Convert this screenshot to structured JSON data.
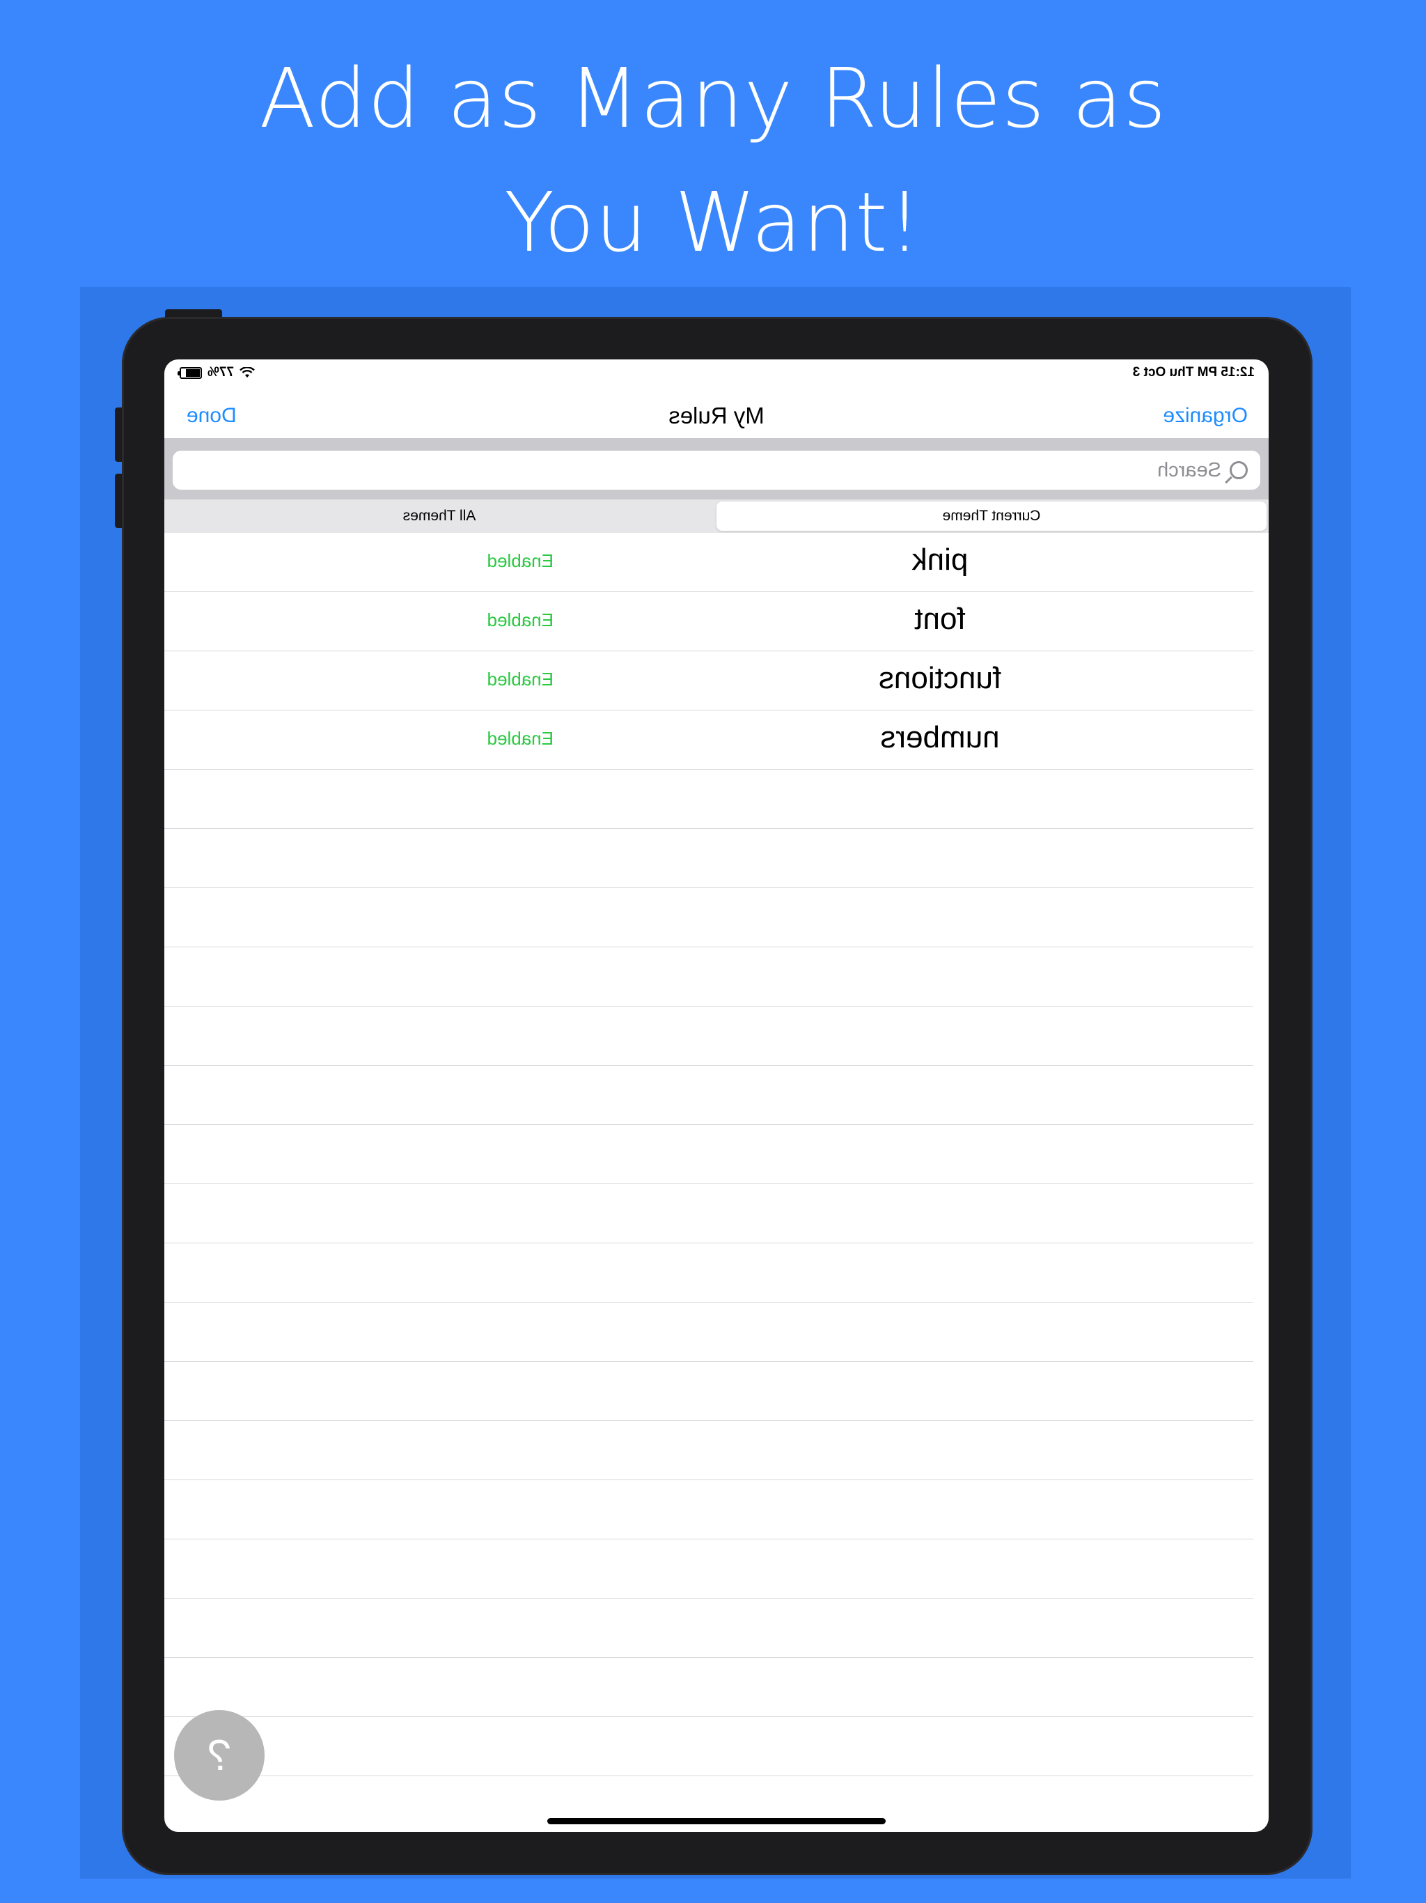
{
  "headline": {
    "line1": "Add as Many Rules as",
    "line2": "You Want!"
  },
  "status_bar": {
    "time_date": "12:15 PM  Thu Oct 3",
    "battery": "77%"
  },
  "nav": {
    "left_button": "Done",
    "title": "My Rules",
    "right_button": "Organize"
  },
  "search": {
    "placeholder": "Search"
  },
  "segments": {
    "current": "Current Theme",
    "all": "All Themes",
    "selected": "Current Theme"
  },
  "rules": [
    {
      "name": "pink",
      "status": "Enabled"
    },
    {
      "name": "font",
      "status": "Enabled"
    },
    {
      "name": "functions",
      "status": "Enabled"
    },
    {
      "name": "numbers",
      "status": "Enabled"
    }
  ],
  "help": {
    "label": "?"
  },
  "colors": {
    "background": "#3a87fd",
    "accent": "#1e8cff",
    "enabled": "#29c940"
  },
  "icons": [
    "search-icon",
    "wifi-icon",
    "battery-icon",
    "help-icon"
  ]
}
